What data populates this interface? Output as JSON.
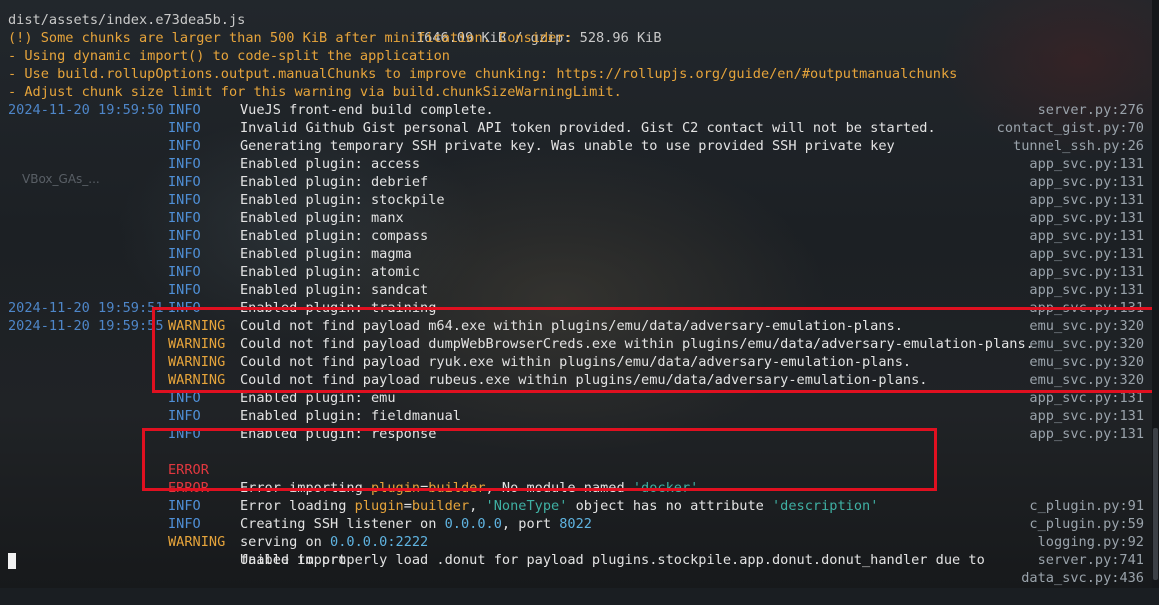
{
  "header_line": {
    "file": "dist/assets/index.e73dea5b.js",
    "size": "1646.09 KiB / gzip: 528.96 KiB"
  },
  "warning_block": [
    "(!) Some chunks are larger than 500 KiB after minification. Consider:",
    "- Using dynamic import() to code-split the application",
    "- Use build.rollupOptions.output.manualChunks to improve chunking: https://rollupjs.org/guide/en/#outputmanualchunks",
    "- Adjust chunk size limit for this warning via build.chunkSizeWarningLimit."
  ],
  "desktop_icon_label": "VBox_GAs_...",
  "logs": [
    {
      "ts": "2024-11-20 19:59:50",
      "level": "INFO",
      "msg": "VueJS front-end build complete.",
      "src": "server.py:276"
    },
    {
      "ts": "",
      "level": "INFO",
      "msg": "Invalid Github Gist personal API token provided. Gist C2 contact will not be started.",
      "src": "contact_gist.py:70"
    },
    {
      "ts": "",
      "level": "INFO",
      "msg": "Generating temporary SSH private key. Was unable to use provided SSH private key",
      "src": "tunnel_ssh.py:26"
    },
    {
      "ts": "",
      "level": "INFO",
      "msg": "Enabled plugin: access",
      "src": "app_svc.py:131"
    },
    {
      "ts": "",
      "level": "INFO",
      "msg": "Enabled plugin: debrief",
      "src": "app_svc.py:131"
    },
    {
      "ts": "",
      "level": "INFO",
      "msg": "Enabled plugin: stockpile",
      "src": "app_svc.py:131"
    },
    {
      "ts": "",
      "level": "INFO",
      "msg": "Enabled plugin: manx",
      "src": "app_svc.py:131"
    },
    {
      "ts": "",
      "level": "INFO",
      "msg": "Enabled plugin: compass",
      "src": "app_svc.py:131"
    },
    {
      "ts": "",
      "level": "INFO",
      "msg": "Enabled plugin: magma",
      "src": "app_svc.py:131"
    },
    {
      "ts": "",
      "level": "INFO",
      "msg": "Enabled plugin: atomic",
      "src": "app_svc.py:131"
    },
    {
      "ts": "",
      "level": "INFO",
      "msg": "Enabled plugin: sandcat",
      "src": "app_svc.py:131"
    },
    {
      "ts": "2024-11-20 19:59:51",
      "level": "INFO",
      "msg": "Enabled plugin: training",
      "src": "app_svc.py:131"
    },
    {
      "ts": "2024-11-20 19:59:55",
      "level": "WARNING",
      "msg": "Could not find payload m64.exe within plugins/emu/data/adversary-emulation-plans.",
      "src": "emu_svc.py:320"
    },
    {
      "ts": "",
      "level": "WARNING",
      "msg": "Could not find payload dumpWebBrowserCreds.exe within plugins/emu/data/adversary-emulation-plans.",
      "src": "emu_svc.py:320"
    },
    {
      "ts": "",
      "level": "WARNING",
      "msg": "Could not find payload ryuk.exe within plugins/emu/data/adversary-emulation-plans.",
      "src": "emu_svc.py:320"
    },
    {
      "ts": "",
      "level": "WARNING",
      "msg": "Could not find payload rubeus.exe within plugins/emu/data/adversary-emulation-plans.",
      "src": "emu_svc.py:320"
    },
    {
      "ts": "",
      "level": "INFO",
      "msg": "Enabled plugin: emu",
      "src": "app_svc.py:131"
    },
    {
      "ts": "",
      "level": "INFO",
      "msg": "Enabled plugin: fieldmanual",
      "src": "app_svc.py:131"
    },
    {
      "ts": "",
      "level": "INFO",
      "msg": "Enabled plugin: response",
      "src": "app_svc.py:131"
    }
  ],
  "error1": {
    "level": "ERROR",
    "pre": "Error importing ",
    "kw": "plugin",
    "eq": "=",
    "kwval": "builder",
    "mid": ", No module named ",
    "str": "'docker'",
    "src": "c_plugin.py:91"
  },
  "error2": {
    "level": "ERROR",
    "pre": "Error loading ",
    "kw": "plugin",
    "eq": "=",
    "kwval": "builder",
    "mid": ", ",
    "str": "'NoneType'",
    "mid2": " object has no attribute ",
    "str2": "'description'",
    "src": "c_plugin.py:59"
  },
  "listener": {
    "level": "INFO",
    "pre": "Creating SSH listener on ",
    "addr": "0.0.0.0",
    "mid": ", port ",
    "port": "8022",
    "src": "logging.py:92"
  },
  "serving": {
    "level": "INFO",
    "pre": "serving on ",
    "addr": "0.0.0.0:2222",
    "src": "server.py:741"
  },
  "donut": {
    "level": "WARNING",
    "msg": "Unable to properly load .donut for payload plugins.stockpile.app.donut.donut_handler due to",
    "msg2": "failed import",
    "src": "data_svc.py:436"
  },
  "colors": {
    "info": "#4f8fd6",
    "warning": "#e6a43b",
    "error": "#e0383f",
    "highlight_box": "#e01020"
  }
}
